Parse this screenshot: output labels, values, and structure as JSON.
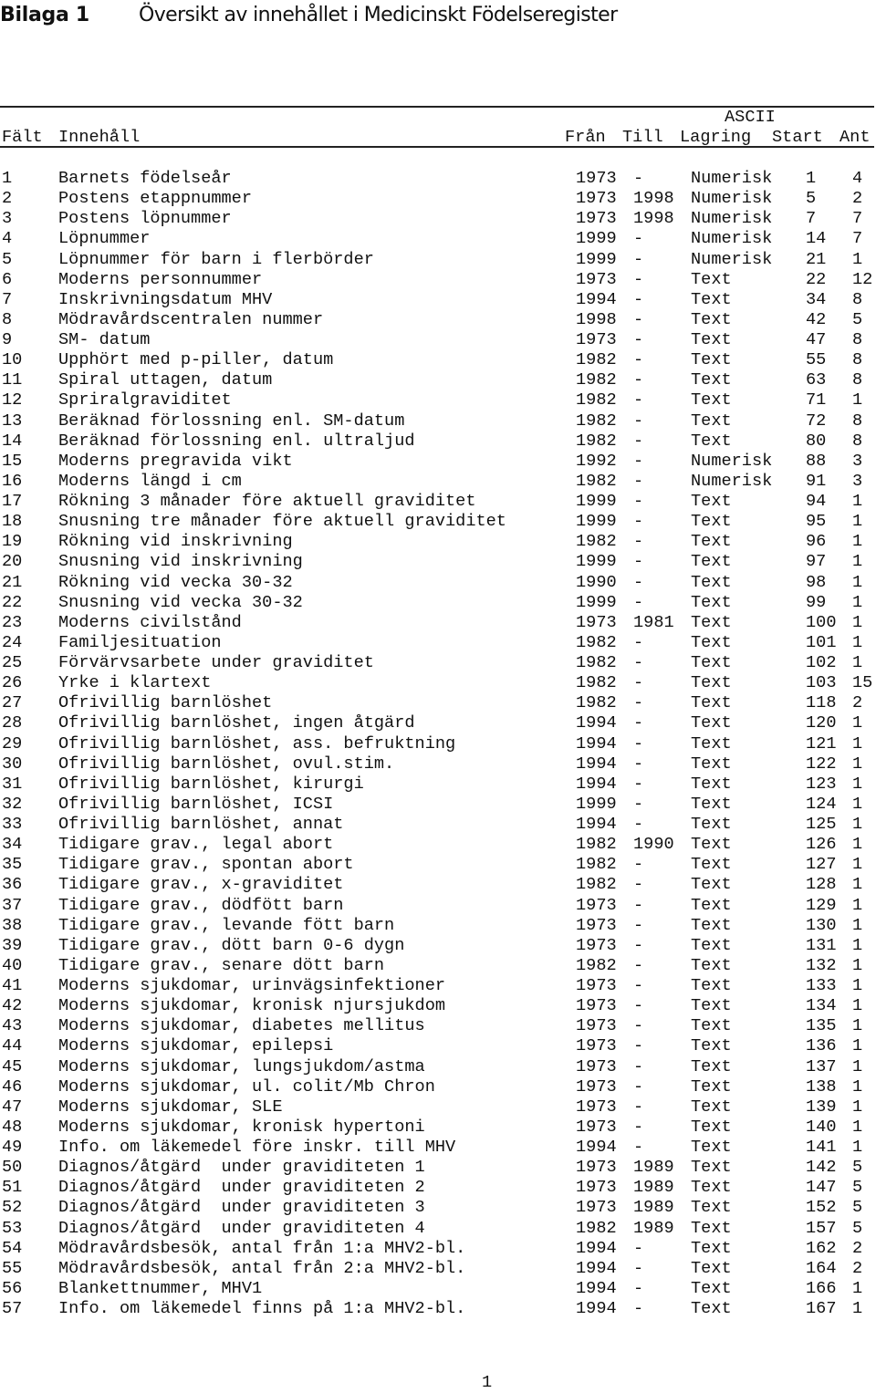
{
  "title": {
    "label": "Bilaga 1",
    "heading": "Översikt av innehållet i Medicinskt Födelseregister"
  },
  "table": {
    "header": {
      "group_label": "ASCII",
      "columns": [
        "Fält",
        "Innehåll",
        "Från",
        "Till",
        "Lagring",
        "Start",
        "Ant"
      ]
    },
    "rows": [
      {
        "falt": "1",
        "innehall": "Barnets födelseår",
        "fran": "1973",
        "till": "-",
        "lagring": "Numerisk",
        "start": "1",
        "ant": "4"
      },
      {
        "falt": "2",
        "innehall": "Postens etappnummer",
        "fran": "1973",
        "till": "1998",
        "lagring": "Numerisk",
        "start": "5",
        "ant": "2"
      },
      {
        "falt": "3",
        "innehall": "Postens löpnummer",
        "fran": "1973",
        "till": "1998",
        "lagring": "Numerisk",
        "start": "7",
        "ant": "7"
      },
      {
        "falt": "4",
        "innehall": "Löpnummer",
        "fran": "1999",
        "till": "-",
        "lagring": "Numerisk",
        "start": "14",
        "ant": "7"
      },
      {
        "falt": "5",
        "innehall": "Löpnummer för barn i flerbörder",
        "fran": "1999",
        "till": "-",
        "lagring": "Numerisk",
        "start": "21",
        "ant": "1"
      },
      {
        "falt": "6",
        "innehall": "Moderns personnummer",
        "fran": "1973",
        "till": "-",
        "lagring": "Text",
        "start": "22",
        "ant": "12"
      },
      {
        "falt": "7",
        "innehall": "Inskrivningsdatum MHV",
        "fran": "1994",
        "till": "-",
        "lagring": "Text",
        "start": "34",
        "ant": "8"
      },
      {
        "falt": "8",
        "innehall": "Mödravårdscentralen nummer",
        "fran": "1998",
        "till": "-",
        "lagring": "Text",
        "start": "42",
        "ant": "5"
      },
      {
        "falt": "9",
        "innehall": "SM- datum",
        "fran": "1973",
        "till": "-",
        "lagring": "Text",
        "start": "47",
        "ant": "8"
      },
      {
        "falt": "10",
        "innehall": "Upphört med p-piller, datum",
        "fran": "1982",
        "till": "-",
        "lagring": "Text",
        "start": "55",
        "ant": "8"
      },
      {
        "falt": "11",
        "innehall": "Spiral uttagen, datum",
        "fran": "1982",
        "till": "-",
        "lagring": "Text",
        "start": "63",
        "ant": "8"
      },
      {
        "falt": "12",
        "innehall": "Spriralgraviditet",
        "fran": "1982",
        "till": "-",
        "lagring": "Text",
        "start": "71",
        "ant": "1"
      },
      {
        "falt": "13",
        "innehall": "Beräknad förlossning enl. SM-datum",
        "fran": "1982",
        "till": "-",
        "lagring": "Text",
        "start": "72",
        "ant": "8"
      },
      {
        "falt": "14",
        "innehall": "Beräknad förlossning enl. ultraljud",
        "fran": "1982",
        "till": "-",
        "lagring": "Text",
        "start": "80",
        "ant": "8"
      },
      {
        "falt": "15",
        "innehall": "Moderns pregravida vikt",
        "fran": "1992",
        "till": "-",
        "lagring": "Numerisk",
        "start": "88",
        "ant": "3"
      },
      {
        "falt": "16",
        "innehall": "Moderns längd i cm",
        "fran": "1982",
        "till": "-",
        "lagring": "Numerisk",
        "start": "91",
        "ant": "3"
      },
      {
        "falt": "17",
        "innehall": "Rökning 3 månader före aktuell graviditet",
        "fran": "1999",
        "till": "-",
        "lagring": "Text",
        "start": "94",
        "ant": "1"
      },
      {
        "falt": "18",
        "innehall": "Snusning tre månader före aktuell graviditet",
        "fran": "1999",
        "till": "-",
        "lagring": "Text",
        "start": "95",
        "ant": "1"
      },
      {
        "falt": "19",
        "innehall": "Rökning vid inskrivning",
        "fran": "1982",
        "till": "-",
        "lagring": "Text",
        "start": "96",
        "ant": "1"
      },
      {
        "falt": "20",
        "innehall": "Snusning vid inskrivning",
        "fran": "1999",
        "till": "-",
        "lagring": "Text",
        "start": "97",
        "ant": "1"
      },
      {
        "falt": "21",
        "innehall": "Rökning vid vecka 30-32",
        "fran": "1990",
        "till": "-",
        "lagring": "Text",
        "start": "98",
        "ant": "1"
      },
      {
        "falt": "22",
        "innehall": "Snusning vid vecka 30-32",
        "fran": "1999",
        "till": "-",
        "lagring": "Text",
        "start": "99",
        "ant": "1"
      },
      {
        "falt": "23",
        "innehall": "Moderns civilstånd",
        "fran": "1973",
        "till": "1981",
        "lagring": "Text",
        "start": "100",
        "ant": "1"
      },
      {
        "falt": "24",
        "innehall": "Familjesituation",
        "fran": "1982",
        "till": "-",
        "lagring": "Text",
        "start": "101",
        "ant": "1"
      },
      {
        "falt": "25",
        "innehall": "Förvärvsarbete under graviditet",
        "fran": "1982",
        "till": "-",
        "lagring": "Text",
        "start": "102",
        "ant": "1"
      },
      {
        "falt": "26",
        "innehall": "Yrke i klartext",
        "fran": "1982",
        "till": "-",
        "lagring": "Text",
        "start": "103",
        "ant": "15"
      },
      {
        "falt": "27",
        "innehall": "Ofrivillig barnlöshet",
        "fran": "1982",
        "till": "-",
        "lagring": "Text",
        "start": "118",
        "ant": "2"
      },
      {
        "falt": "28",
        "innehall": "Ofrivillig barnlöshet, ingen åtgärd",
        "fran": "1994",
        "till": "-",
        "lagring": "Text",
        "start": "120",
        "ant": "1"
      },
      {
        "falt": "29",
        "innehall": "Ofrivillig barnlöshet, ass. befruktning",
        "fran": "1994",
        "till": "-",
        "lagring": "Text",
        "start": "121",
        "ant": "1"
      },
      {
        "falt": "30",
        "innehall": "Ofrivillig barnlöshet, ovul.stim.",
        "fran": "1994",
        "till": "-",
        "lagring": "Text",
        "start": "122",
        "ant": "1"
      },
      {
        "falt": "31",
        "innehall": "Ofrivillig barnlöshet, kirurgi",
        "fran": "1994",
        "till": "-",
        "lagring": "Text",
        "start": "123",
        "ant": "1"
      },
      {
        "falt": "32",
        "innehall": "Ofrivillig barnlöshet, ICSI",
        "fran": "1999",
        "till": "-",
        "lagring": "Text",
        "start": "124",
        "ant": "1"
      },
      {
        "falt": "33",
        "innehall": "Ofrivillig barnlöshet, annat",
        "fran": "1994",
        "till": "-",
        "lagring": "Text",
        "start": "125",
        "ant": "1"
      },
      {
        "falt": "34",
        "innehall": "Tidigare grav., legal abort",
        "fran": "1982",
        "till": "1990",
        "lagring": "Text",
        "start": "126",
        "ant": "1"
      },
      {
        "falt": "35",
        "innehall": "Tidigare grav., spontan abort",
        "fran": "1982",
        "till": "-",
        "lagring": "Text",
        "start": "127",
        "ant": "1"
      },
      {
        "falt": "36",
        "innehall": "Tidigare grav., x-graviditet",
        "fran": "1982",
        "till": "-",
        "lagring": "Text",
        "start": "128",
        "ant": "1"
      },
      {
        "falt": "37",
        "innehall": "Tidigare grav., dödfött barn",
        "fran": "1973",
        "till": "-",
        "lagring": "Text",
        "start": "129",
        "ant": "1"
      },
      {
        "falt": "38",
        "innehall": "Tidigare grav., levande fött barn",
        "fran": "1973",
        "till": "-",
        "lagring": "Text",
        "start": "130",
        "ant": "1"
      },
      {
        "falt": "39",
        "innehall": "Tidigare grav., dött barn 0-6 dygn",
        "fran": "1973",
        "till": "-",
        "lagring": "Text",
        "start": "131",
        "ant": "1"
      },
      {
        "falt": "40",
        "innehall": "Tidigare grav., senare dött barn",
        "fran": "1982",
        "till": "-",
        "lagring": "Text",
        "start": "132",
        "ant": "1"
      },
      {
        "falt": "41",
        "innehall": "Moderns sjukdomar, urinvägsinfektioner",
        "fran": "1973",
        "till": "-",
        "lagring": "Text",
        "start": "133",
        "ant": "1"
      },
      {
        "falt": "42",
        "innehall": "Moderns sjukdomar, kronisk njursjukdom",
        "fran": "1973",
        "till": "-",
        "lagring": "Text",
        "start": "134",
        "ant": "1"
      },
      {
        "falt": "43",
        "innehall": "Moderns sjukdomar, diabetes mellitus",
        "fran": "1973",
        "till": "-",
        "lagring": "Text",
        "start": "135",
        "ant": "1"
      },
      {
        "falt": "44",
        "innehall": "Moderns sjukdomar, epilepsi",
        "fran": "1973",
        "till": "-",
        "lagring": "Text",
        "start": "136",
        "ant": "1"
      },
      {
        "falt": "45",
        "innehall": "Moderns sjukdomar, lungsjukdom/astma",
        "fran": "1973",
        "till": "-",
        "lagring": "Text",
        "start": "137",
        "ant": "1"
      },
      {
        "falt": "46",
        "innehall": "Moderns sjukdomar, ul. colit/Mb Chron",
        "fran": "1973",
        "till": "-",
        "lagring": "Text",
        "start": "138",
        "ant": "1"
      },
      {
        "falt": "47",
        "innehall": "Moderns sjukdomar, SLE",
        "fran": "1973",
        "till": "-",
        "lagring": "Text",
        "start": "139",
        "ant": "1"
      },
      {
        "falt": "48",
        "innehall": "Moderns sjukdomar, kronisk hypertoni",
        "fran": "1973",
        "till": "-",
        "lagring": "Text",
        "start": "140",
        "ant": "1"
      },
      {
        "falt": "49",
        "innehall": "Info. om läkemedel före inskr. till MHV",
        "fran": "1994",
        "till": "-",
        "lagring": "Text",
        "start": "141",
        "ant": "1"
      },
      {
        "falt": "50",
        "innehall": "Diagnos/åtgärd  under graviditeten 1",
        "fran": "1973",
        "till": "1989",
        "lagring": "Text",
        "start": "142",
        "ant": "5"
      },
      {
        "falt": "51",
        "innehall": "Diagnos/åtgärd  under graviditeten 2",
        "fran": "1973",
        "till": "1989",
        "lagring": "Text",
        "start": "147",
        "ant": "5"
      },
      {
        "falt": "52",
        "innehall": "Diagnos/åtgärd  under graviditeten 3",
        "fran": "1973",
        "till": "1989",
        "lagring": "Text",
        "start": "152",
        "ant": "5"
      },
      {
        "falt": "53",
        "innehall": "Diagnos/åtgärd  under graviditeten 4",
        "fran": "1982",
        "till": "1989",
        "lagring": "Text",
        "start": "157",
        "ant": "5"
      },
      {
        "falt": "54",
        "innehall": "Mödravårdsbesök, antal från 1:a MHV2-bl.",
        "fran": "1994",
        "till": "-",
        "lagring": "Text",
        "start": "162",
        "ant": "2"
      },
      {
        "falt": "55",
        "innehall": "Mödravårdsbesök, antal från 2:a MHV2-bl.",
        "fran": "1994",
        "till": "-",
        "lagring": "Text",
        "start": "164",
        "ant": "2"
      },
      {
        "falt": "56",
        "innehall": "Blankettnummer, MHV1",
        "fran": "1994",
        "till": "-",
        "lagring": "Text",
        "start": "166",
        "ant": "1"
      },
      {
        "falt": "57",
        "innehall": "Info. om läkemedel finns på 1:a MHV2-bl.",
        "fran": "1994",
        "till": "-",
        "lagring": "Text",
        "start": "167",
        "ant": "1"
      }
    ]
  },
  "footer": {
    "page_number": "1"
  }
}
